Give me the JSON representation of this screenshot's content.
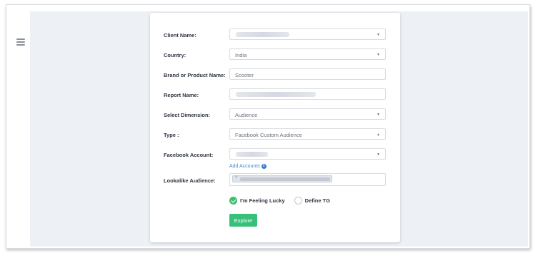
{
  "form": {
    "client_name": {
      "label": "Client Name:",
      "value": ""
    },
    "country": {
      "label": "Country:",
      "value": "India"
    },
    "brand": {
      "label": "Brand or Product Name:",
      "value": "Scooter"
    },
    "report_name": {
      "label": "Report Name:",
      "value": ""
    },
    "dimension": {
      "label": "Select Dimension:",
      "value": "Audience"
    },
    "type": {
      "label": "Type :",
      "value": "Facebook Custom Audience"
    },
    "facebook_account": {
      "label": "Facebook Account:",
      "value": "",
      "add_link": "Add Accounts"
    },
    "lookalike": {
      "label": "Lookalike Audience:",
      "tag_remove": "×"
    },
    "options": {
      "lucky": "I'm Feeling Lucky",
      "define": "Define TG"
    },
    "explore_label": "Explore"
  },
  "icons": {
    "menu": "hamburger-menu-icon",
    "caret_down": "▼",
    "caret_up": "▲",
    "info": "i"
  },
  "colors": {
    "accent_green": "#36c07a",
    "link_blue": "#3b8fd9",
    "page_bg": "#edf0f5"
  }
}
